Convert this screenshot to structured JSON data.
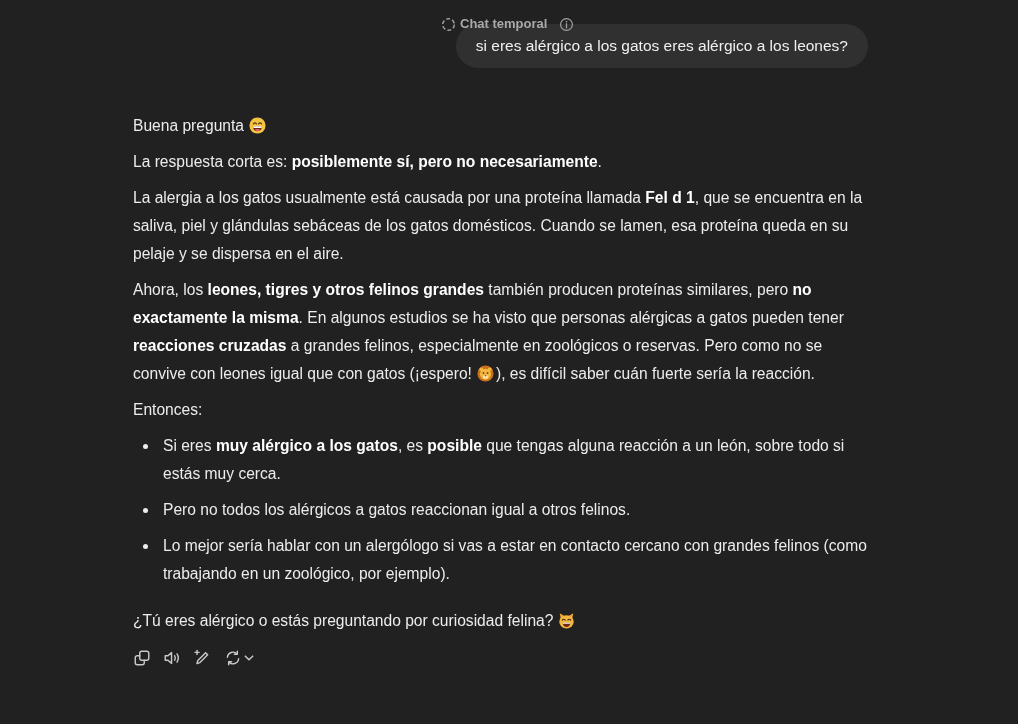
{
  "header": {
    "title": "Chat temporal"
  },
  "user_message": {
    "text": "si eres alérgico a los gatos eres alérgico a los leones?"
  },
  "response": {
    "blocks": [
      {
        "kind": "paragraph",
        "text": "Buena pregunta",
        "emoji": true
      },
      {
        "kind": "paragraph",
        "text": "La respuesta corta es: **posiblemente sí, pero no necesariamente**."
      },
      {
        "kind": "paragraph",
        "text": "La alergia a los gatos usualmente está causada por una proteína llamada **Fel d 1**, que se encuentra en la saliva, piel y glándulas sebáceas de los gatos domésticos. Cuando se lamen, esa proteína queda en su pelaje y se dispersa en el aire."
      },
      {
        "kind": "paragraph",
        "text": "Ahora, los **leones, tigres y otros felinos grandes** también producen proteínas similares, pero **no exactamente la misma**. En algunos estudios se ha visto que personas alérgicas a gatos pueden tener **reacciones cruzadas** a grandes felinos, especialmente en zoológicos o reservas. Pero como no se convive con leones igual que con gatos (¡espero!",
        "emoji": true,
        "text_after": "), es difícil saber cuán fuerte sería la reacción."
      },
      {
        "kind": "paragraph",
        "text": "Entonces:"
      },
      {
        "kind": "list",
        "items": [
          "Si eres **muy alérgico a los gatos**, es **posible** que tengas alguna reacción a un león, sobre todo si estás muy cerca.",
          "Pero no todos los alérgicos a gatos reaccionan igual a otros felinos.",
          "Lo mejor sería hablar con un alergólogo si vas a estar en contacto cercano con grandes felinos (como trabajando en un zoológico, por ejemplo)."
        ]
      },
      {
        "kind": "closing",
        "text": "¿Tú eres alérgico o estás preguntando por curiosidad felina?",
        "emoji": true
      }
    ]
  }
}
